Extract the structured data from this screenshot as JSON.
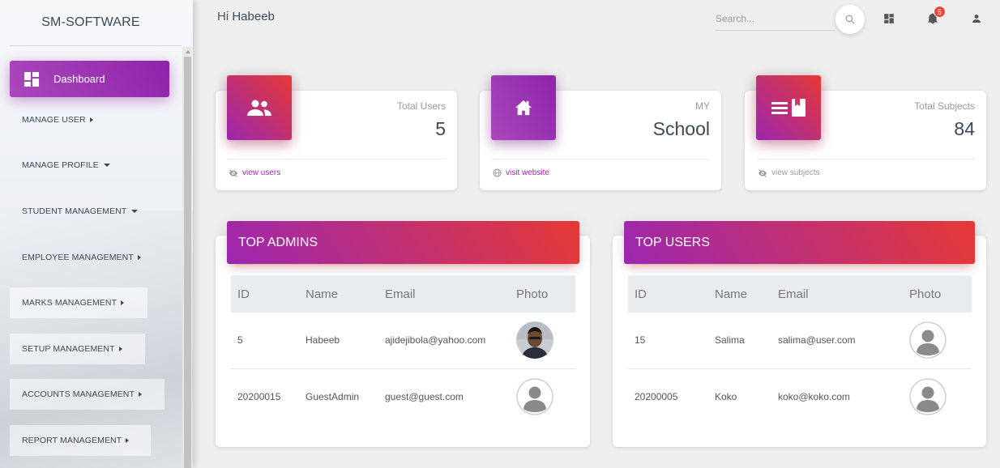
{
  "brand": "SM-SOFTWARE",
  "sidebar": {
    "active": "Dashboard",
    "items": [
      {
        "label": "MANAGE USER",
        "caret": "right"
      },
      {
        "label": "MANAGE PROFILE",
        "caret": "down"
      },
      {
        "label": "STUDENT MANAGEMENT",
        "caret": "down"
      },
      {
        "label": "EMPLOYEE MANAGEMENT",
        "caret": "right"
      },
      {
        "label": "MARKS MANAGEMENT",
        "caret": "right"
      },
      {
        "label": "SETUP MANAGEMENT",
        "caret": "right"
      },
      {
        "label": "ACCOUNTS MANAGEMENT",
        "caret": "right"
      },
      {
        "label": "REPORT MANAGEMENT",
        "caret": "right"
      }
    ]
  },
  "header": {
    "greeting": "Hi",
    "user_name": "Habeeb",
    "search_placeholder": "Search...",
    "notification_count": "5"
  },
  "stats": [
    {
      "label": "Total Users",
      "value": "5",
      "footer": "view users",
      "icon": "group-icon"
    },
    {
      "label": "MY",
      "value": "School",
      "footer": "visit website",
      "icon": "home-icon"
    },
    {
      "label": "Total Subjects",
      "value": "84",
      "footer": "view subjects",
      "icon": "subjects-icon"
    }
  ],
  "top_admins": {
    "title": "TOP ADMINS",
    "columns": [
      "ID",
      "Name",
      "Email",
      "Photo"
    ],
    "rows": [
      {
        "id": "5",
        "name": "Habeeb",
        "email": "ajidejibola@yahoo.com",
        "photo": "user-photo"
      },
      {
        "id": "20200015",
        "name": "GuestAdmin",
        "email": "guest@guest.com",
        "photo": "default-avatar"
      }
    ]
  },
  "top_users": {
    "title": "TOP USERS",
    "columns": [
      "ID",
      "Name",
      "Email",
      "Photo"
    ],
    "rows": [
      {
        "id": "15",
        "name": "Salima",
        "email": "salima@user.com",
        "photo": "default-avatar"
      },
      {
        "id": "20200005",
        "name": "Koko",
        "email": "koko@koko.com",
        "photo": "default-avatar"
      }
    ]
  },
  "colors": {
    "primary_purple": "#9c27b0",
    "accent_red": "#e53935",
    "badge_red": "#f44336"
  }
}
